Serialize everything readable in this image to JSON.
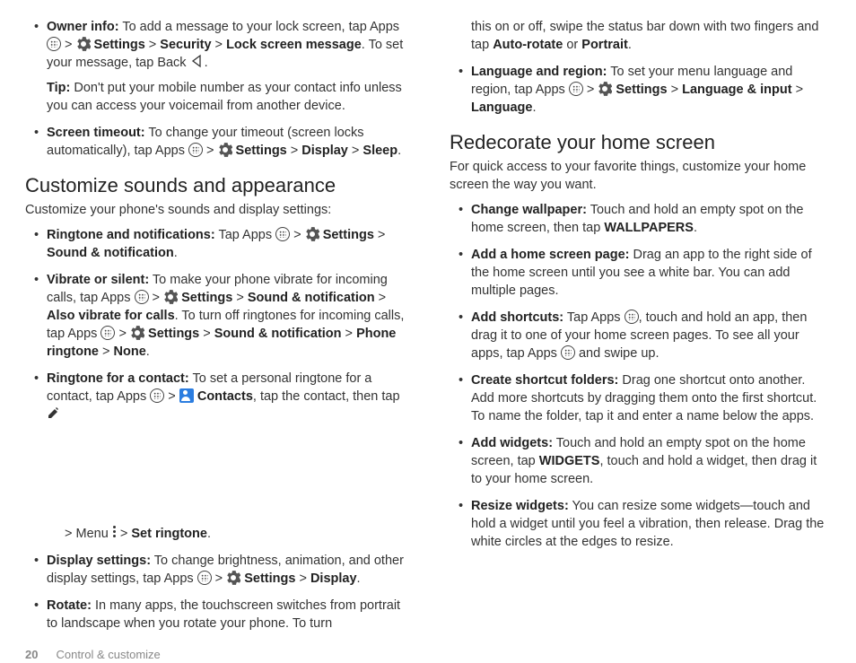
{
  "footer": {
    "page": "20",
    "section": "Control & customize"
  },
  "col1": {
    "ownerInfo": {
      "label": "Owner info:",
      "t1": " To add a message to your lock screen, tap Apps ",
      "gt1": " > ",
      "settings": " Settings",
      "gt2": " > ",
      "security": "Security",
      "gt3": " > ",
      "lockMsg": "Lock screen message",
      "t2": ". To set your message, tap Back ",
      "dot": ".",
      "tipLabel": "Tip:",
      "tipText": " Don't put your mobile number as your contact info unless you can access your voicemail from another device."
    },
    "screenTimeout": {
      "label": "Screen timeout:",
      "t1": " To change your timeout (screen locks automatically), tap Apps ",
      "gt1": " > ",
      "settings": " Settings",
      "gt2": " > ",
      "display": "Display",
      "gt3": " > ",
      "sleep": "Sleep",
      "dot": "."
    },
    "h1": "Customize sounds and appearance",
    "h1sub": "Customize your phone's sounds and display settings:",
    "ringtone": {
      "label": "Ringtone and notifications:",
      "t1": " Tap Apps ",
      "gt1": " > ",
      "settings": " Settings",
      "gt2": " > ",
      "sound": "Sound & notification",
      "dot": "."
    },
    "vibrate": {
      "label": "Vibrate or silent:",
      "t1": " To make your phone vibrate for incoming calls, tap Apps ",
      "gt1": " > ",
      "settings": " Settings",
      "gt2": " > ",
      "sound1": "Sound & notification",
      "gt3": " > ",
      "also": "Also vibrate for calls",
      "t2": ". To turn off ringtones for incoming calls, tap Apps ",
      "gt4": " > ",
      "settings2": " Settings",
      "gt5": " > ",
      "sound2": "Sound & notification",
      "gt6": " > ",
      "phoneRing": "Phone ringtone",
      "gt7": " > ",
      "none": "None",
      "dot": "."
    },
    "contactRing": {
      "label": "Ringtone for a contact:",
      "t1": " To set a personal ringtone for a contact, tap Apps ",
      "gt1": " > ",
      "contacts": " Contacts",
      "t2": ", tap the contact, then tap ",
      "gt2": " > Menu ",
      "gt3": " > ",
      "setRing": "Set ringtone",
      "dot": "."
    },
    "display": {
      "label": "Display settings:",
      "t1": " To change brightness, animation, and other display settings, tap Apps ",
      "gt1": " > ",
      "settings": " Settings",
      "gt2": " > ",
      "disp": "Display",
      "dot": "."
    },
    "rotate": {
      "label": "Rotate:",
      "t1": " In many apps, the touchscreen switches from portrait to landscape when you rotate your phone. To turn "
    }
  },
  "col2": {
    "rotateCont": {
      "t1": "this on or off, swipe the status bar down with two fingers and tap ",
      "auto": "Auto-rotate",
      "or": " or ",
      "portrait": "Portrait",
      "dot": "."
    },
    "lang": {
      "label": "Language and region:",
      "t1": " To set your menu language and region, tap Apps ",
      "gt1": " > ",
      "settings": " Settings",
      "gt2": " > ",
      "langInput": "Language & input",
      "gt3": " > ",
      "language": "Language",
      "dot": "."
    },
    "h2": "Redecorate your home screen",
    "h2sub": "For quick access to your favorite things, customize your home screen the way you want.",
    "wallpaper": {
      "label": "Change wallpaper:",
      "t1": " Touch and hold an empty spot on the home screen, then tap ",
      "wall": "WALLPAPERS",
      "dot": "."
    },
    "addPage": {
      "label": "Add a home screen page:",
      "t1": " Drag an app to the right side of the home screen until you see a white bar. You can add multiple pages."
    },
    "shortcuts": {
      "label": "Add shortcuts:",
      "t1": " Tap Apps ",
      "t2": ", touch and hold an app, then drag it to one of your home screen pages. To see all your apps, tap Apps ",
      "t3": " and swipe up."
    },
    "folders": {
      "label": "Create shortcut folders:",
      "t1": " Drag one shortcut onto another. Add more shortcuts by dragging them onto the first shortcut. To name the folder, tap it and enter a name below the apps."
    },
    "widgets": {
      "label": "Add widgets:",
      "t1": " Touch and hold an empty spot on the home screen, tap ",
      "w": "WIDGETS",
      "t2": ", touch and hold a widget, then drag it to your home screen."
    },
    "resize": {
      "label": "Resize widgets:",
      "t1": " You can resize some widgets—touch and hold a widget until you feel a vibration, then release. Drag the white circles at the edges to resize."
    }
  }
}
